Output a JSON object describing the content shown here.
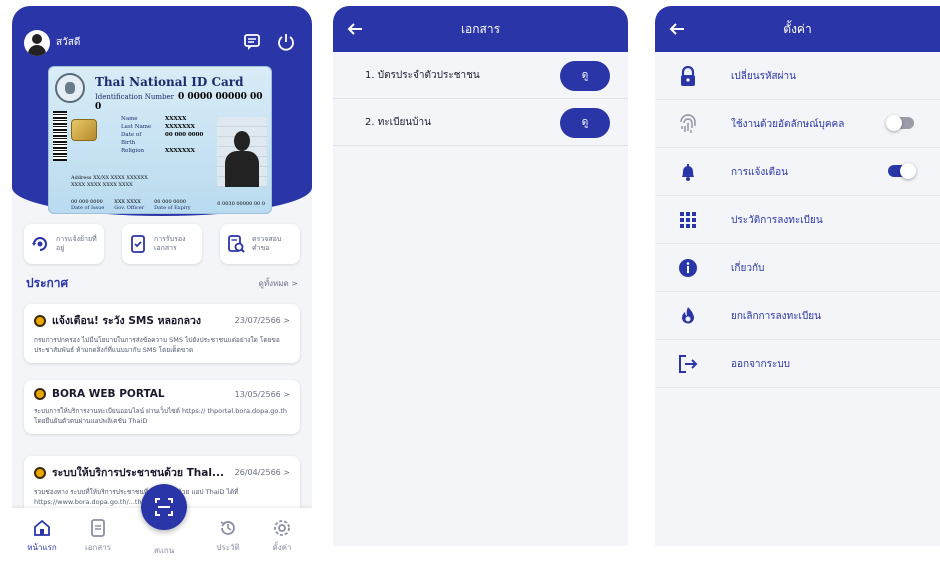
{
  "colors": {
    "primary": "#2a36a8",
    "bg": "#f4f5f9",
    "accent": "#e8a800"
  },
  "home": {
    "greeting": "สวัสดี",
    "icons": [
      "chat-icon",
      "power-icon"
    ],
    "id_card": {
      "title": "Thai National ID Card",
      "id_label": "Identification Number",
      "id_number": "0 0000 00000 00 0",
      "fields": [
        {
          "key": "Name",
          "value": "XXXXX"
        },
        {
          "key": "Last Name",
          "value": "XXXXXXX"
        },
        {
          "key": "Date of Birth",
          "value": "00 000 0000"
        },
        {
          "key": "Religion",
          "value": "XXXXXXX"
        }
      ],
      "address_line1": "Address XX/XX XXXX XXXXXX",
      "address_line2": "XXXX XXXX XXXX XXXX",
      "issue_value": "00 000 0000",
      "issue_label": "Date of Issue",
      "officer_value": "XXX XXXX",
      "officer_label": "Gov. Officer",
      "expiry_value": "00 000 0000",
      "expiry_label": "Date of Expiry",
      "card_number": "0 0030 00000 00 0"
    },
    "quick_actions": [
      {
        "label": "การแจ้งย้ายที่อยู่",
        "icon": "address-move-icon"
      },
      {
        "label": "การรับรองเอกสาร",
        "icon": "document-certify-icon"
      },
      {
        "label": "ตรวจสอบคำขอ",
        "icon": "request-check-icon"
      }
    ],
    "announcements_title": "ประกาศ",
    "see_all": "ดูทั้งหมด >",
    "news": [
      {
        "title": "แจ้งเตือน! ระวัง SMS หลอกลวง",
        "date": "23/07/2566 >",
        "body": "กรมการปกครอง ไม่มีนโยบายในการส่งข้อความ SMS ไปยังประชาชนแต่อย่างใด โดยขอประชาสัมพันธ์ ห้ามกดลิงก์ที่แนบมากับ SMS โดยเด็ดขาด"
      },
      {
        "title": "BORA WEB PORTAL",
        "date": "13/05/2566 >",
        "body": "ระบบการให้บริการงานทะเบียนออนไลน์ ผ่านเว็บไซต์ https:// thportal.bora.dopa.go.th โดยยืนยันตัวตนผ่านแอปพลิเคชัน ThaiD"
      },
      {
        "title": "ระบบให้บริการประชาชนด้วย Thal...",
        "date": "26/04/2566 >",
        "body": "รวมช่องทาง ระบบที่ให้บริการประชาชนที่เข้าสู่ระบบด้วย แอป ThaiD ได้ที่ https://www.bora.dopa.go.th/...then_services/"
      }
    ],
    "nav": [
      {
        "label": "หน้าแรก",
        "icon": "home-icon"
      },
      {
        "label": "เอกสาร",
        "icon": "document-icon"
      },
      {
        "label": "สแกน",
        "icon": "scan-icon"
      },
      {
        "label": "ประวัติ",
        "icon": "history-icon"
      },
      {
        "label": "ตั้งค่า",
        "icon": "gear-icon"
      }
    ]
  },
  "documents": {
    "title": "เอกสาร",
    "items": [
      {
        "label": "1. บัตรประจำตัวประชาชน",
        "button": "ดู"
      },
      {
        "label": "2. ทะเบียนบ้าน",
        "button": "ดู"
      }
    ]
  },
  "settings": {
    "title": "ตั้งค่า",
    "items": [
      {
        "label": "เปลี่ยนรหัสผ่าน",
        "icon": "lock-icon"
      },
      {
        "label": "ใช้งานด้วยอัตลักษณ์บุคคล",
        "icon": "fingerprint-icon",
        "toggle": false
      },
      {
        "label": "การแจ้งเตือน",
        "icon": "bell-icon",
        "toggle": true
      },
      {
        "label": "ประวัติการลงทะเบียน",
        "icon": "grid-icon"
      },
      {
        "label": "เกี่ยวกับ",
        "icon": "info-icon"
      },
      {
        "label": "ยกเลิกการลงทะเบียน",
        "icon": "flame-icon"
      },
      {
        "label": "ออกจากระบบ",
        "icon": "logout-icon"
      }
    ]
  }
}
